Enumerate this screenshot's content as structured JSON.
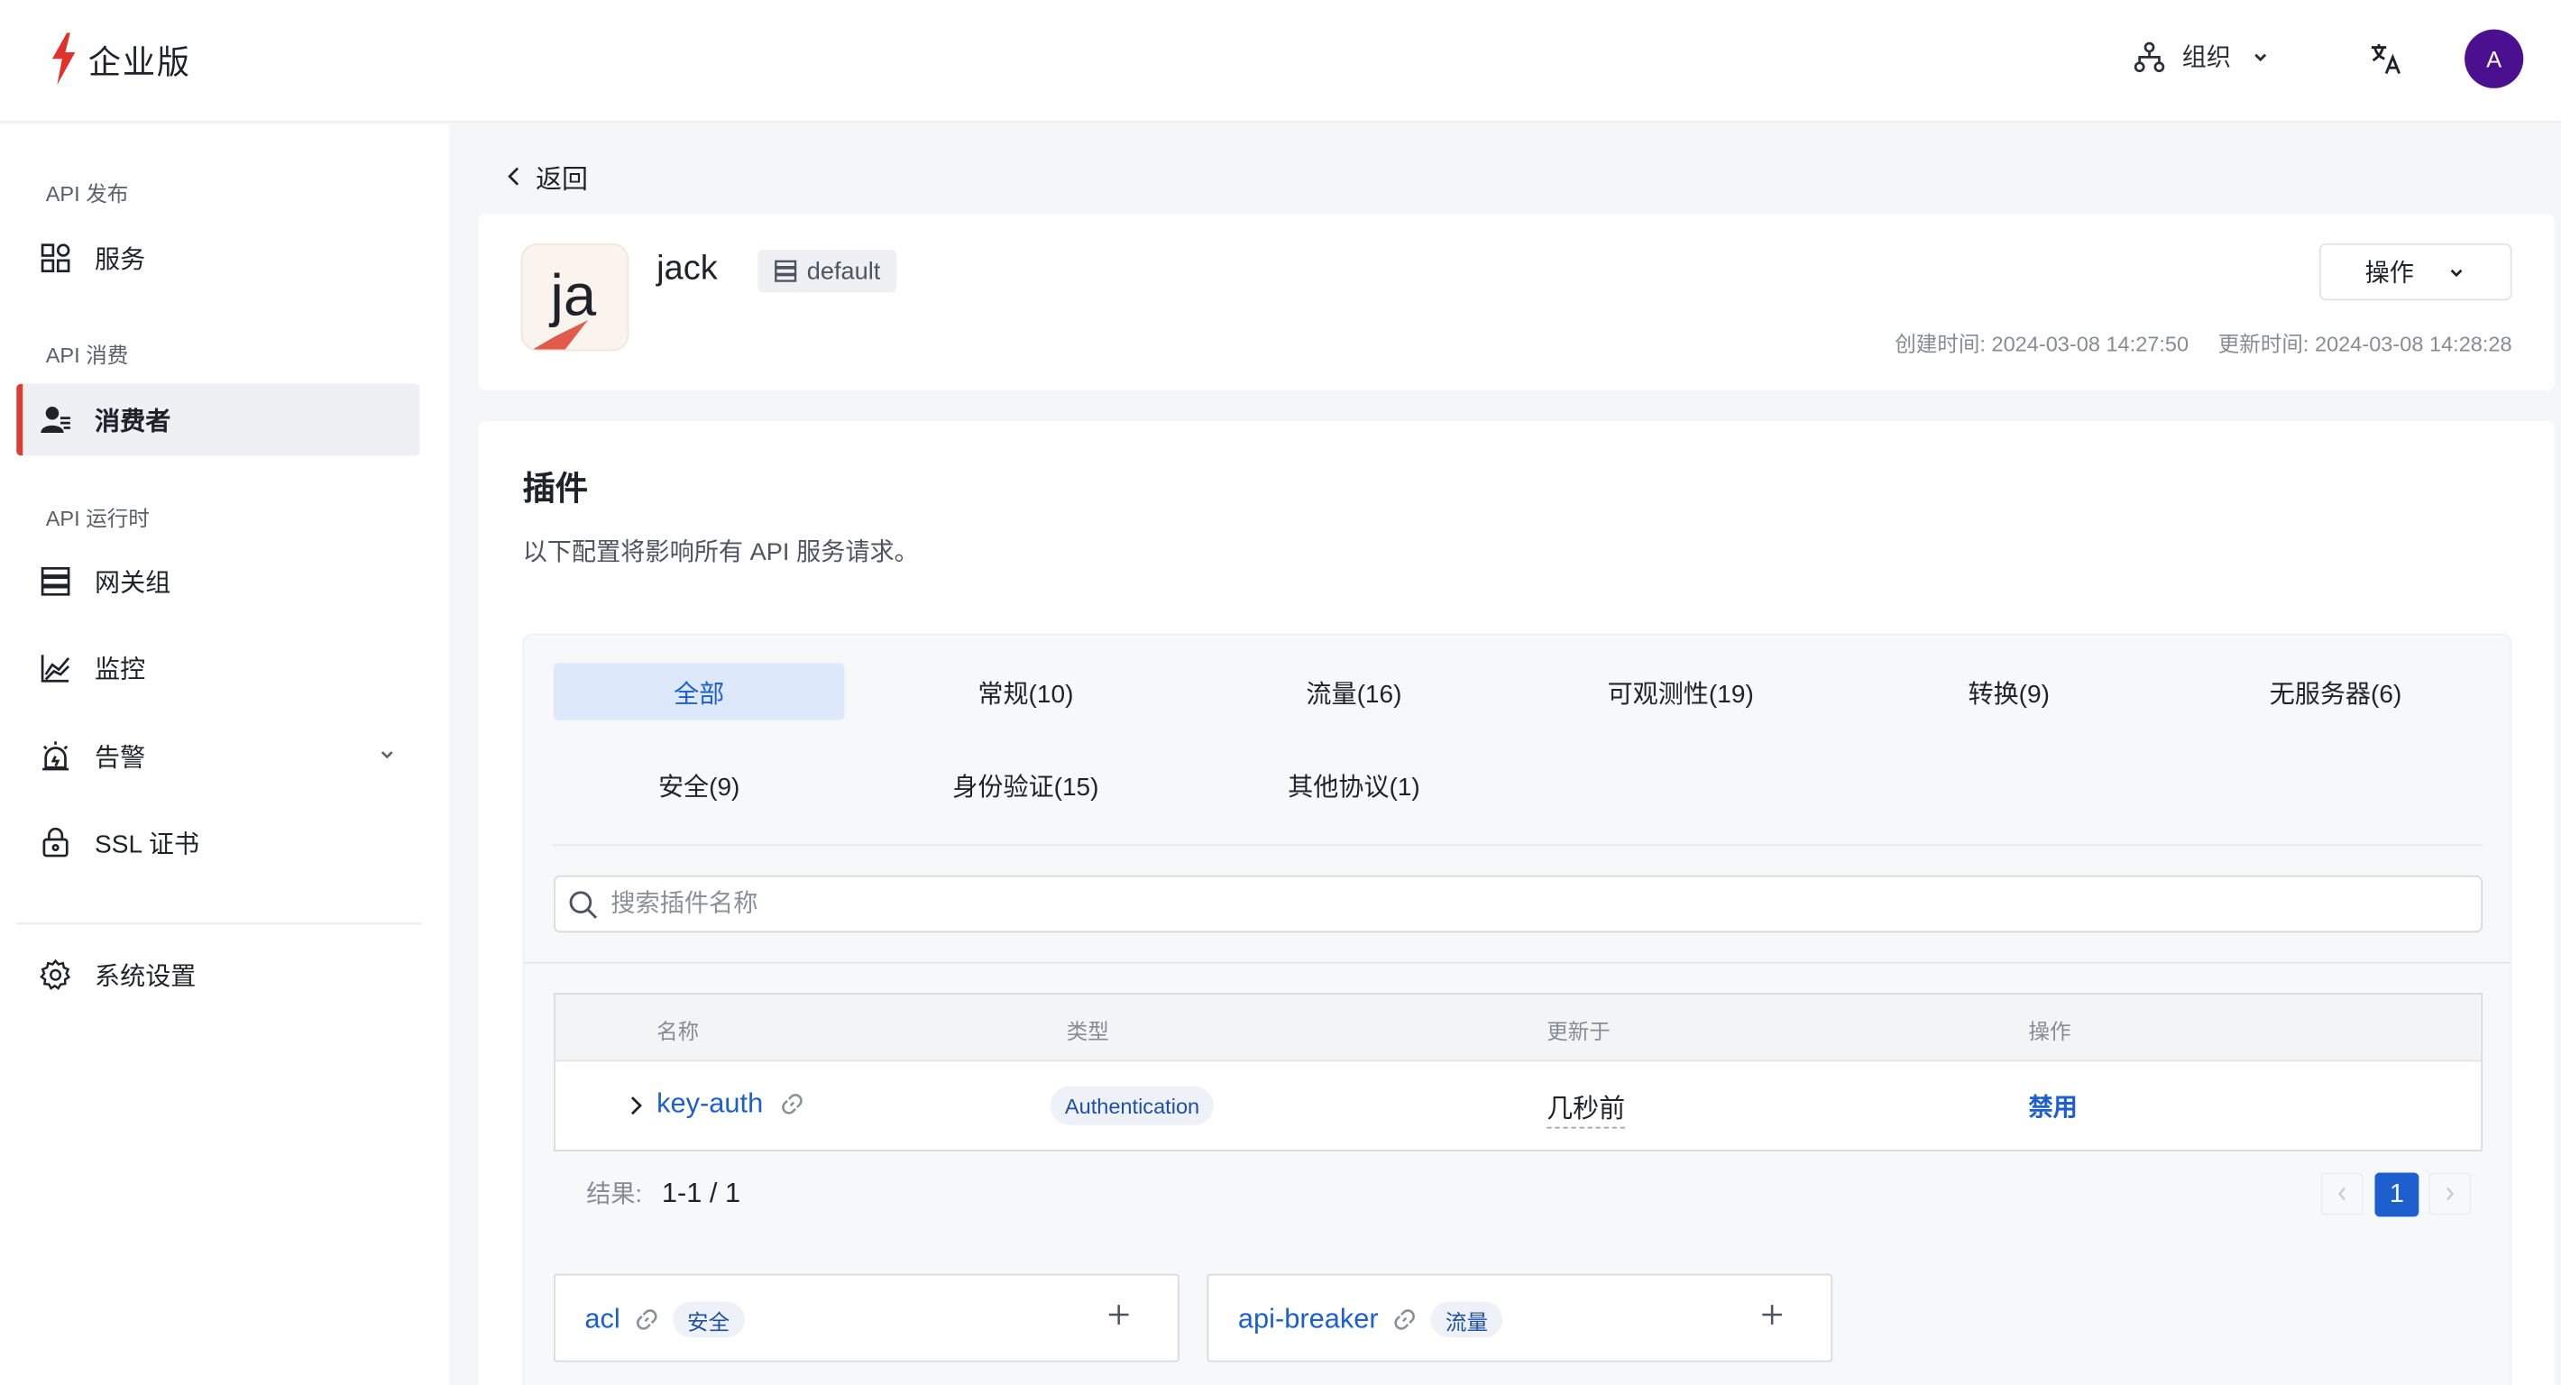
{
  "header": {
    "brand": "企业版",
    "org_label": "组织",
    "avatar_initial": "A",
    "avatar_color": "#4a108f"
  },
  "sidebar": {
    "sections": [
      {
        "label": "API 发布",
        "items": [
          {
            "label": "服务",
            "icon": "services-icon"
          }
        ]
      },
      {
        "label": "API 消费",
        "items": [
          {
            "label": "消费者",
            "icon": "consumer-icon",
            "active": true
          }
        ]
      },
      {
        "label": "API 运行时",
        "items": [
          {
            "label": "网关组",
            "icon": "gateway-icon"
          },
          {
            "label": "监控",
            "icon": "monitor-icon"
          },
          {
            "label": "告警",
            "icon": "alarm-icon"
          },
          {
            "label": "SSL 证书",
            "icon": "lock-icon"
          }
        ]
      }
    ],
    "settings_label": "系统设置",
    "accent": "#d93e33"
  },
  "page": {
    "back_label": "返回",
    "consumer": {
      "avatar_text": "ja",
      "name": "jack",
      "gateway_group": "default",
      "ops_label": "操作",
      "created": "创建时间: 2024-03-08 14:27:50",
      "updated": "更新时间: 2024-03-08 14:28:28"
    },
    "plugins": {
      "title": "插件",
      "description": "以下配置将影响所有 API 服务请求。",
      "tabs": [
        {
          "label": "全部",
          "active": true
        },
        {
          "label": "常规(10)"
        },
        {
          "label": "流量(16)"
        },
        {
          "label": "可观测性(19)"
        },
        {
          "label": "转换(9)"
        },
        {
          "label": "无服务器(6)"
        },
        {
          "label": "安全(9)"
        },
        {
          "label": "身份验证(15)"
        },
        {
          "label": "其他协议(1)"
        }
      ],
      "search_placeholder": "搜索插件名称",
      "table": {
        "columns": [
          "名称",
          "类型",
          "更新于",
          "操作"
        ],
        "rows": [
          {
            "name": "key-auth",
            "type": "Authentication",
            "updated": "几秒前",
            "action": "禁用"
          }
        ]
      },
      "result_label": "结果:",
      "result_value": "1-1 / 1",
      "current_page": "1",
      "cards": [
        {
          "name": "acl",
          "category": "安全"
        },
        {
          "name": "api-breaker",
          "category": "流量"
        }
      ],
      "link_color": "#1e5fcf"
    }
  }
}
